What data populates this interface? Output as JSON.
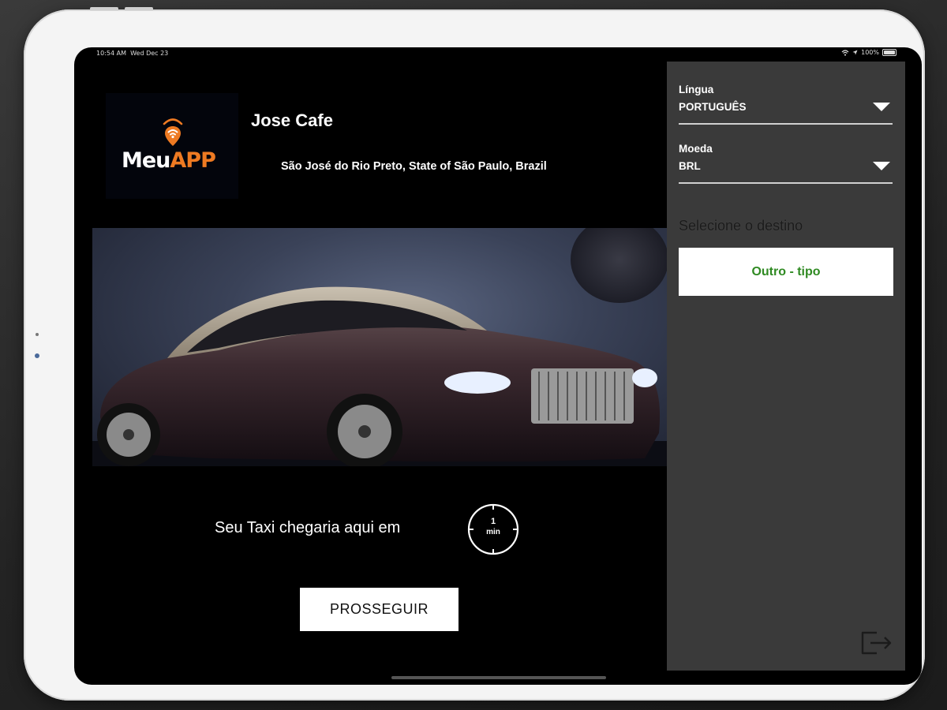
{
  "statusbar": {
    "time": "10:54 AM",
    "date": "Wed Dec 23",
    "battery": "100%",
    "icons": [
      "wifi-icon",
      "location-icon",
      "battery-icon"
    ]
  },
  "brand": {
    "logo_part1": "Meu",
    "logo_part2": "APP",
    "logo_colors": {
      "text": "#ffffff",
      "accent": "#ee7a22"
    },
    "icon": "location-pin-wifi-icon"
  },
  "header": {
    "name": "Jose Cafe",
    "address": "São José do Rio Preto, State of São Paulo, Brazil"
  },
  "main": {
    "image": "luxury-car-photo",
    "eta_text": "Seu Taxi chegaria aqui em",
    "eta_value": "1",
    "eta_unit": "min",
    "proceed_label": "PROSSEGUIR"
  },
  "panel": {
    "language": {
      "label": "Língua",
      "value": "PORTUGUÊS"
    },
    "currency": {
      "label": "Moeda",
      "value": "BRL"
    },
    "destination_title": "Selecione o destino",
    "destination_button": "Outro - tipo",
    "logout_icon": "logout-icon"
  },
  "colors": {
    "background": "#000000",
    "panel": "#3a3a3a",
    "destination_text": "#2f8a22",
    "button_bg": "#ffffff"
  }
}
